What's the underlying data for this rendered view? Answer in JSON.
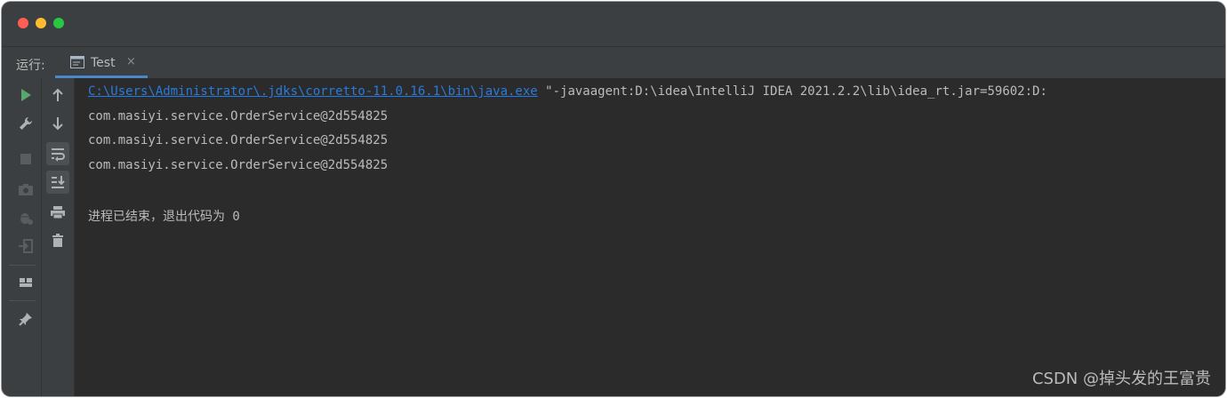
{
  "run_panel": {
    "label": "运行:",
    "tab": {
      "label": "Test",
      "close": "×"
    }
  },
  "left_toolbar": [
    {
      "name": "rerun-icon"
    },
    {
      "name": "wrench-icon"
    },
    {
      "name": "stop-icon"
    },
    {
      "name": "camera-icon"
    },
    {
      "name": "debug-icon"
    },
    {
      "name": "exit-icon"
    },
    {
      "name": "layout-icon"
    },
    {
      "name": "pin-icon"
    }
  ],
  "right_toolbar": [
    {
      "name": "up-arrow-icon"
    },
    {
      "name": "down-arrow-icon"
    },
    {
      "name": "soft-wrap-icon"
    },
    {
      "name": "scroll-to-end-icon"
    },
    {
      "name": "print-icon"
    },
    {
      "name": "trash-icon"
    }
  ],
  "console": {
    "command_path": "C:\\Users\\Administrator\\.jdks\\corretto-11.0.16.1\\bin\\java.exe",
    "command_args": " \"-javaagent:D:\\idea\\IntelliJ IDEA 2021.2.2\\lib\\idea_rt.jar=59602:D:",
    "output_lines": [
      "com.masiyi.service.OrderService@2d554825",
      "com.masiyi.service.OrderService@2d554825",
      "com.masiyi.service.OrderService@2d554825"
    ],
    "exit_message": "进程已结束，退出代码为 0"
  },
  "watermark": "CSDN @掉头发的王富贵",
  "colors": {
    "background": "#2b2b2b",
    "panel": "#3c3f41",
    "link": "#287bde",
    "text": "#bbbbbb",
    "run_green": "#59a869"
  }
}
